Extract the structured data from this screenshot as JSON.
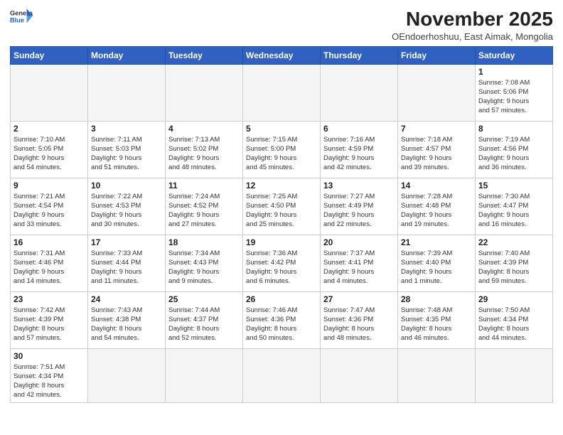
{
  "header": {
    "logo_line1": "General",
    "logo_line2": "Blue",
    "title": "November 2025",
    "subtitle": "OEndoerhoshuu, East Aimak, Mongolia"
  },
  "weekdays": [
    "Sunday",
    "Monday",
    "Tuesday",
    "Wednesday",
    "Thursday",
    "Friday",
    "Saturday"
  ],
  "weeks": [
    [
      {
        "day": "",
        "info": ""
      },
      {
        "day": "",
        "info": ""
      },
      {
        "day": "",
        "info": ""
      },
      {
        "day": "",
        "info": ""
      },
      {
        "day": "",
        "info": ""
      },
      {
        "day": "",
        "info": ""
      },
      {
        "day": "1",
        "info": "Sunrise: 7:08 AM\nSunset: 5:06 PM\nDaylight: 9 hours\nand 57 minutes."
      }
    ],
    [
      {
        "day": "2",
        "info": "Sunrise: 7:10 AM\nSunset: 5:05 PM\nDaylight: 9 hours\nand 54 minutes."
      },
      {
        "day": "3",
        "info": "Sunrise: 7:11 AM\nSunset: 5:03 PM\nDaylight: 9 hours\nand 51 minutes."
      },
      {
        "day": "4",
        "info": "Sunrise: 7:13 AM\nSunset: 5:02 PM\nDaylight: 9 hours\nand 48 minutes."
      },
      {
        "day": "5",
        "info": "Sunrise: 7:15 AM\nSunset: 5:00 PM\nDaylight: 9 hours\nand 45 minutes."
      },
      {
        "day": "6",
        "info": "Sunrise: 7:16 AM\nSunset: 4:59 PM\nDaylight: 9 hours\nand 42 minutes."
      },
      {
        "day": "7",
        "info": "Sunrise: 7:18 AM\nSunset: 4:57 PM\nDaylight: 9 hours\nand 39 minutes."
      },
      {
        "day": "8",
        "info": "Sunrise: 7:19 AM\nSunset: 4:56 PM\nDaylight: 9 hours\nand 36 minutes."
      }
    ],
    [
      {
        "day": "9",
        "info": "Sunrise: 7:21 AM\nSunset: 4:54 PM\nDaylight: 9 hours\nand 33 minutes."
      },
      {
        "day": "10",
        "info": "Sunrise: 7:22 AM\nSunset: 4:53 PM\nDaylight: 9 hours\nand 30 minutes."
      },
      {
        "day": "11",
        "info": "Sunrise: 7:24 AM\nSunset: 4:52 PM\nDaylight: 9 hours\nand 27 minutes."
      },
      {
        "day": "12",
        "info": "Sunrise: 7:25 AM\nSunset: 4:50 PM\nDaylight: 9 hours\nand 25 minutes."
      },
      {
        "day": "13",
        "info": "Sunrise: 7:27 AM\nSunset: 4:49 PM\nDaylight: 9 hours\nand 22 minutes."
      },
      {
        "day": "14",
        "info": "Sunrise: 7:28 AM\nSunset: 4:48 PM\nDaylight: 9 hours\nand 19 minutes."
      },
      {
        "day": "15",
        "info": "Sunrise: 7:30 AM\nSunset: 4:47 PM\nDaylight: 9 hours\nand 16 minutes."
      }
    ],
    [
      {
        "day": "16",
        "info": "Sunrise: 7:31 AM\nSunset: 4:46 PM\nDaylight: 9 hours\nand 14 minutes."
      },
      {
        "day": "17",
        "info": "Sunrise: 7:33 AM\nSunset: 4:44 PM\nDaylight: 9 hours\nand 11 minutes."
      },
      {
        "day": "18",
        "info": "Sunrise: 7:34 AM\nSunset: 4:43 PM\nDaylight: 9 hours\nand 9 minutes."
      },
      {
        "day": "19",
        "info": "Sunrise: 7:36 AM\nSunset: 4:42 PM\nDaylight: 9 hours\nand 6 minutes."
      },
      {
        "day": "20",
        "info": "Sunrise: 7:37 AM\nSunset: 4:41 PM\nDaylight: 9 hours\nand 4 minutes."
      },
      {
        "day": "21",
        "info": "Sunrise: 7:39 AM\nSunset: 4:40 PM\nDaylight: 9 hours\nand 1 minute."
      },
      {
        "day": "22",
        "info": "Sunrise: 7:40 AM\nSunset: 4:39 PM\nDaylight: 8 hours\nand 59 minutes."
      }
    ],
    [
      {
        "day": "23",
        "info": "Sunrise: 7:42 AM\nSunset: 4:39 PM\nDaylight: 8 hours\nand 57 minutes."
      },
      {
        "day": "24",
        "info": "Sunrise: 7:43 AM\nSunset: 4:38 PM\nDaylight: 8 hours\nand 54 minutes."
      },
      {
        "day": "25",
        "info": "Sunrise: 7:44 AM\nSunset: 4:37 PM\nDaylight: 8 hours\nand 52 minutes."
      },
      {
        "day": "26",
        "info": "Sunrise: 7:46 AM\nSunset: 4:36 PM\nDaylight: 8 hours\nand 50 minutes."
      },
      {
        "day": "27",
        "info": "Sunrise: 7:47 AM\nSunset: 4:36 PM\nDaylight: 8 hours\nand 48 minutes."
      },
      {
        "day": "28",
        "info": "Sunrise: 7:48 AM\nSunset: 4:35 PM\nDaylight: 8 hours\nand 46 minutes."
      },
      {
        "day": "29",
        "info": "Sunrise: 7:50 AM\nSunset: 4:34 PM\nDaylight: 8 hours\nand 44 minutes."
      }
    ],
    [
      {
        "day": "30",
        "info": "Sunrise: 7:51 AM\nSunset: 4:34 PM\nDaylight: 8 hours\nand 42 minutes."
      },
      {
        "day": "",
        "info": ""
      },
      {
        "day": "",
        "info": ""
      },
      {
        "day": "",
        "info": ""
      },
      {
        "day": "",
        "info": ""
      },
      {
        "day": "",
        "info": ""
      },
      {
        "day": "",
        "info": ""
      }
    ]
  ]
}
